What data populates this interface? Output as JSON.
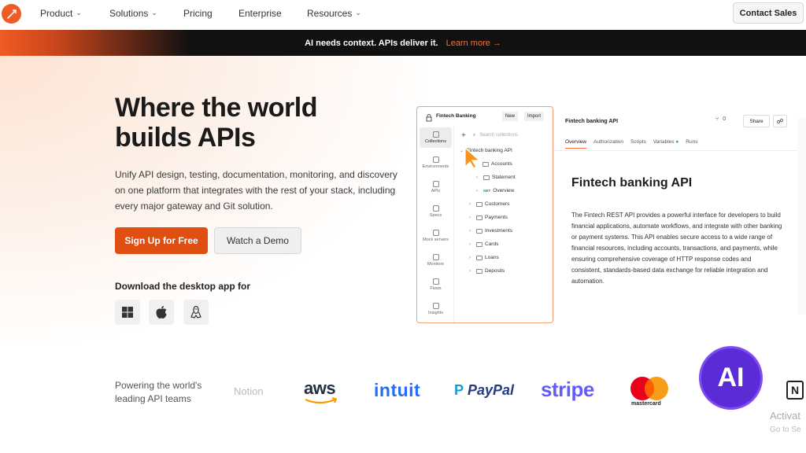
{
  "nav": {
    "items": [
      {
        "label": "Product",
        "has_menu": true
      },
      {
        "label": "Solutions",
        "has_menu": true
      },
      {
        "label": "Pricing",
        "has_menu": false
      },
      {
        "label": "Enterprise",
        "has_menu": false
      },
      {
        "label": "Resources",
        "has_menu": true
      }
    ],
    "contact_label": "Contact Sales"
  },
  "banner": {
    "text": "AI needs context. APIs deliver it.",
    "link": "Learn more →"
  },
  "hero": {
    "title": "Where the world builds APIs",
    "subtitle": "Unify API design, testing, documentation, monitoring, and discovery on one platform that integrates with the rest of your stack, including every major gateway and Git solution.",
    "primary_cta": "Sign Up for Free",
    "secondary_cta": "Watch a Demo",
    "download_label": "Download the desktop app for"
  },
  "app": {
    "workspace": "Fintech Banking",
    "new_label": "New",
    "import_label": "Import",
    "search_placeholder": "Search collections",
    "rail": [
      "Collections",
      "Environments",
      "APIs",
      "Specs",
      "Mock servers",
      "Monitors",
      "Flows",
      "Insights"
    ],
    "tree": {
      "root": "Fintech banking API",
      "accounts": "Accounts",
      "statement": "Statement",
      "overview_method": "GET",
      "overview": "Overview",
      "folders": [
        "Customers",
        "Payments",
        "Investments",
        "Cards",
        "Loans",
        "Deposits"
      ]
    },
    "doc": {
      "header_title": "Fintech banking API",
      "fork_count": "0",
      "share_label": "Share",
      "tabs": [
        "Overview",
        "Authorization",
        "Scripts",
        "Variables",
        "Runs"
      ],
      "heading": "Fintech banking API",
      "body": "The Fintech REST API provides a powerful interface for developers to build financial applications, automate workflows, and integrate with other banking or payment systems. This API enables secure access to a wide range of financial resources, including accounts, transactions, and payments, while ensuring comprehensive coverage of HTTP response codes and consistent, standards-based data exchange for reliable integration and automation."
    }
  },
  "customers": {
    "label": "Powering the world's leading API teams",
    "logos": [
      "Notion",
      "aws",
      "intuit",
      "PayPal",
      "stripe",
      "mastercard",
      "AI",
      "N"
    ]
  },
  "overlay": {
    "activate_line1": "Activat",
    "activate_line2": "Go to Se"
  },
  "colors": {
    "brand": "#ff6c37",
    "cta": "#e04f12",
    "banner_bg": "#111111"
  }
}
